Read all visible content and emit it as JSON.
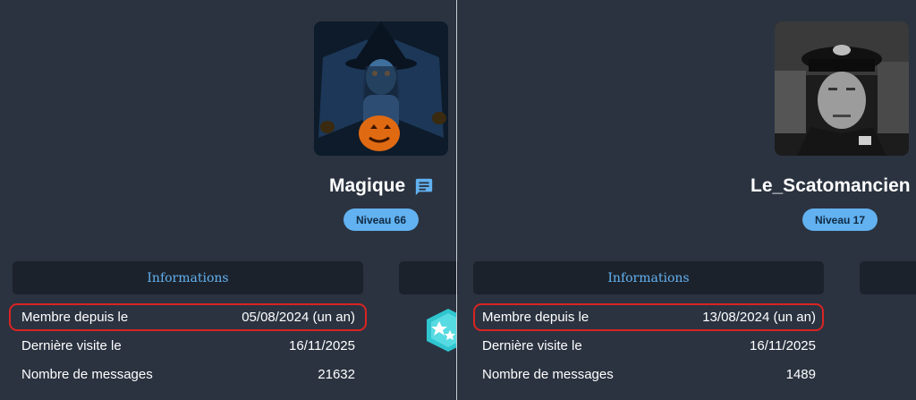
{
  "profiles": [
    {
      "username": "Magique",
      "level": "Niveau 66",
      "tab_label": "Informations",
      "rows": [
        {
          "label": "Membre depuis le",
          "value": "05/08/2024 (un an)"
        },
        {
          "label": "Dernière visite le",
          "value": "16/11/2025"
        },
        {
          "label": "Nombre de messages",
          "value": "21632"
        }
      ]
    },
    {
      "username": "Le_Scatomancien",
      "level": "Niveau 17",
      "tab_label": "Informations",
      "rows": [
        {
          "label": "Membre depuis le",
          "value": "13/08/2024 (un an)"
        },
        {
          "label": "Dernière visite le",
          "value": "16/11/2025"
        },
        {
          "label": "Nombre de messages",
          "value": "1489"
        }
      ]
    }
  ],
  "icons": {
    "message": "chat-bubble-icon",
    "badge": "star-badge-icon"
  },
  "colors": {
    "background": "#2b3340",
    "accent": "#62b1f0",
    "tab_background": "#1c222b",
    "highlight": "#d92424"
  }
}
